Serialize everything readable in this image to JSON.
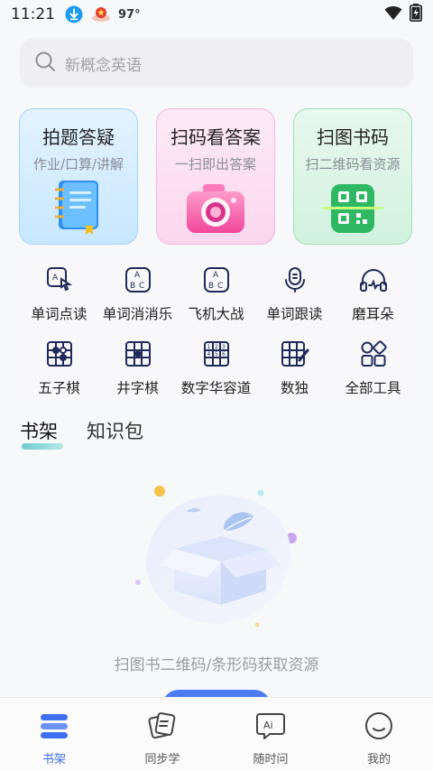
{
  "status_bar": {
    "time": "11:21",
    "temperature": "97°"
  },
  "search": {
    "placeholder": "新概念英语"
  },
  "feature_cards": [
    {
      "title": "拍题答疑",
      "subtitle": "作业/口算/讲解"
    },
    {
      "title": "扫码看答案",
      "subtitle": "一扫即出答案"
    },
    {
      "title": "扫图书码",
      "subtitle": "扫二维码看资源"
    }
  ],
  "tools": [
    {
      "label": "单词点读",
      "icon": "word-tap-read-icon"
    },
    {
      "label": "单词消消乐",
      "icon": "word-match-icon"
    },
    {
      "label": "飞机大战",
      "icon": "plane-battle-icon"
    },
    {
      "label": "单词跟读",
      "icon": "word-follow-read-icon"
    },
    {
      "label": "磨耳朵",
      "icon": "headphones-icon"
    },
    {
      "label": "五子棋",
      "icon": "gomoku-icon"
    },
    {
      "label": "井字棋",
      "icon": "tic-tac-toe-icon"
    },
    {
      "label": "数字华容道",
      "icon": "number-slide-icon"
    },
    {
      "label": "数独",
      "icon": "sudoku-icon"
    },
    {
      "label": "全部工具",
      "icon": "all-tools-icon"
    }
  ],
  "tabs": [
    {
      "label": "书架",
      "active": true
    },
    {
      "label": "知识包",
      "active": false
    }
  ],
  "empty_state": {
    "message": "扫图书二维码/条形码获取资源"
  },
  "bottom_nav": [
    {
      "label": "书架",
      "active": true,
      "icon": "bookshelf-icon"
    },
    {
      "label": "同步学",
      "active": false,
      "icon": "sync-learn-icon"
    },
    {
      "label": "随时问",
      "active": false,
      "icon": "ai-ask-icon"
    },
    {
      "label": "我的",
      "active": false,
      "icon": "profile-icon"
    }
  ],
  "colors": {
    "accent": "#3f6ff2",
    "tool_icon": "#1f2a5a"
  }
}
